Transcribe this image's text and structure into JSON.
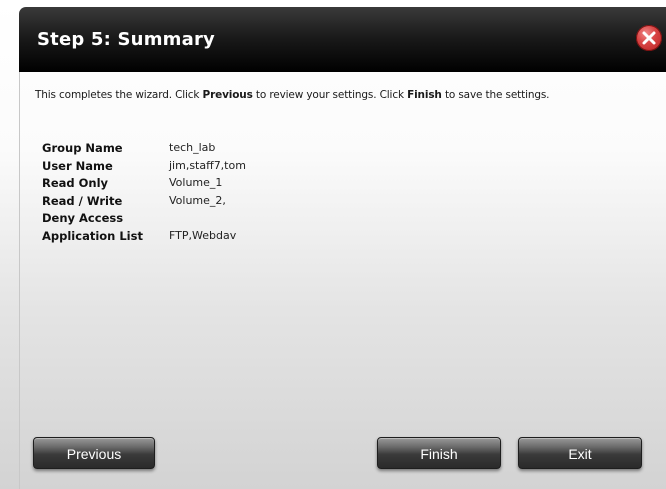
{
  "dialog": {
    "title": "Step 5: Summary",
    "intro": {
      "part1": "This completes the wizard. Click ",
      "previous_word": "Previous",
      "part2": " to review your settings. Click ",
      "finish_word": "Finish",
      "part3": " to save the settings."
    },
    "summary": [
      {
        "label": "Group Name",
        "value": "tech_lab"
      },
      {
        "label": "User Name",
        "value": "jim,staff7,tom"
      },
      {
        "label": "Read Only",
        "value": "Volume_1"
      },
      {
        "label": "Read / Write",
        "value": "Volume_2,"
      },
      {
        "label": "Deny Access",
        "value": ""
      },
      {
        "label": "Application List",
        "value": "FTP,Webdav"
      }
    ],
    "buttons": {
      "previous": "Previous",
      "finish": "Finish",
      "exit": "Exit"
    }
  },
  "colors": {
    "titlebar": "#000000",
    "close_button": "#d94545",
    "button": "#3a3a3a"
  },
  "icons": {
    "close": "close-icon"
  }
}
